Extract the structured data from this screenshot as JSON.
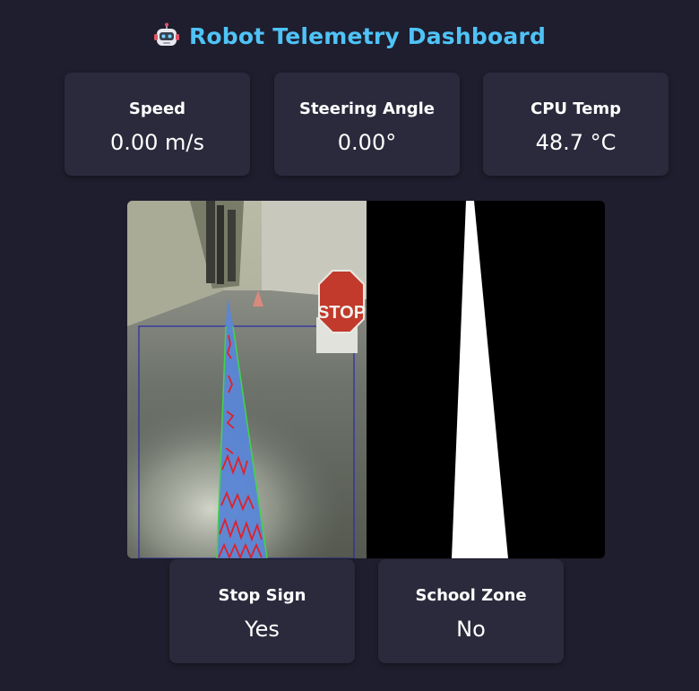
{
  "header": {
    "title": "Robot Telemetry Dashboard",
    "icon": "robot-icon",
    "title_color": "#4fc3f7"
  },
  "metrics": [
    {
      "label": "Speed",
      "value": "0.00 m/s"
    },
    {
      "label": "Steering Angle",
      "value": "0.00°"
    },
    {
      "label": "CPU Temp",
      "value": "48.7 °C"
    }
  ],
  "video": {
    "stop_sign_text": "STOP"
  },
  "detections": [
    {
      "label": "Stop Sign",
      "value": "Yes"
    },
    {
      "label": "School Zone",
      "value": "No"
    }
  ],
  "colors": {
    "background": "#1e1e2e",
    "card": "#2a2a3c",
    "lane_fill": "#5b86d6",
    "lane_edge": "#3fd64a",
    "lane_marks": "#e0202a",
    "roi_box": "#2a2aa8"
  }
}
